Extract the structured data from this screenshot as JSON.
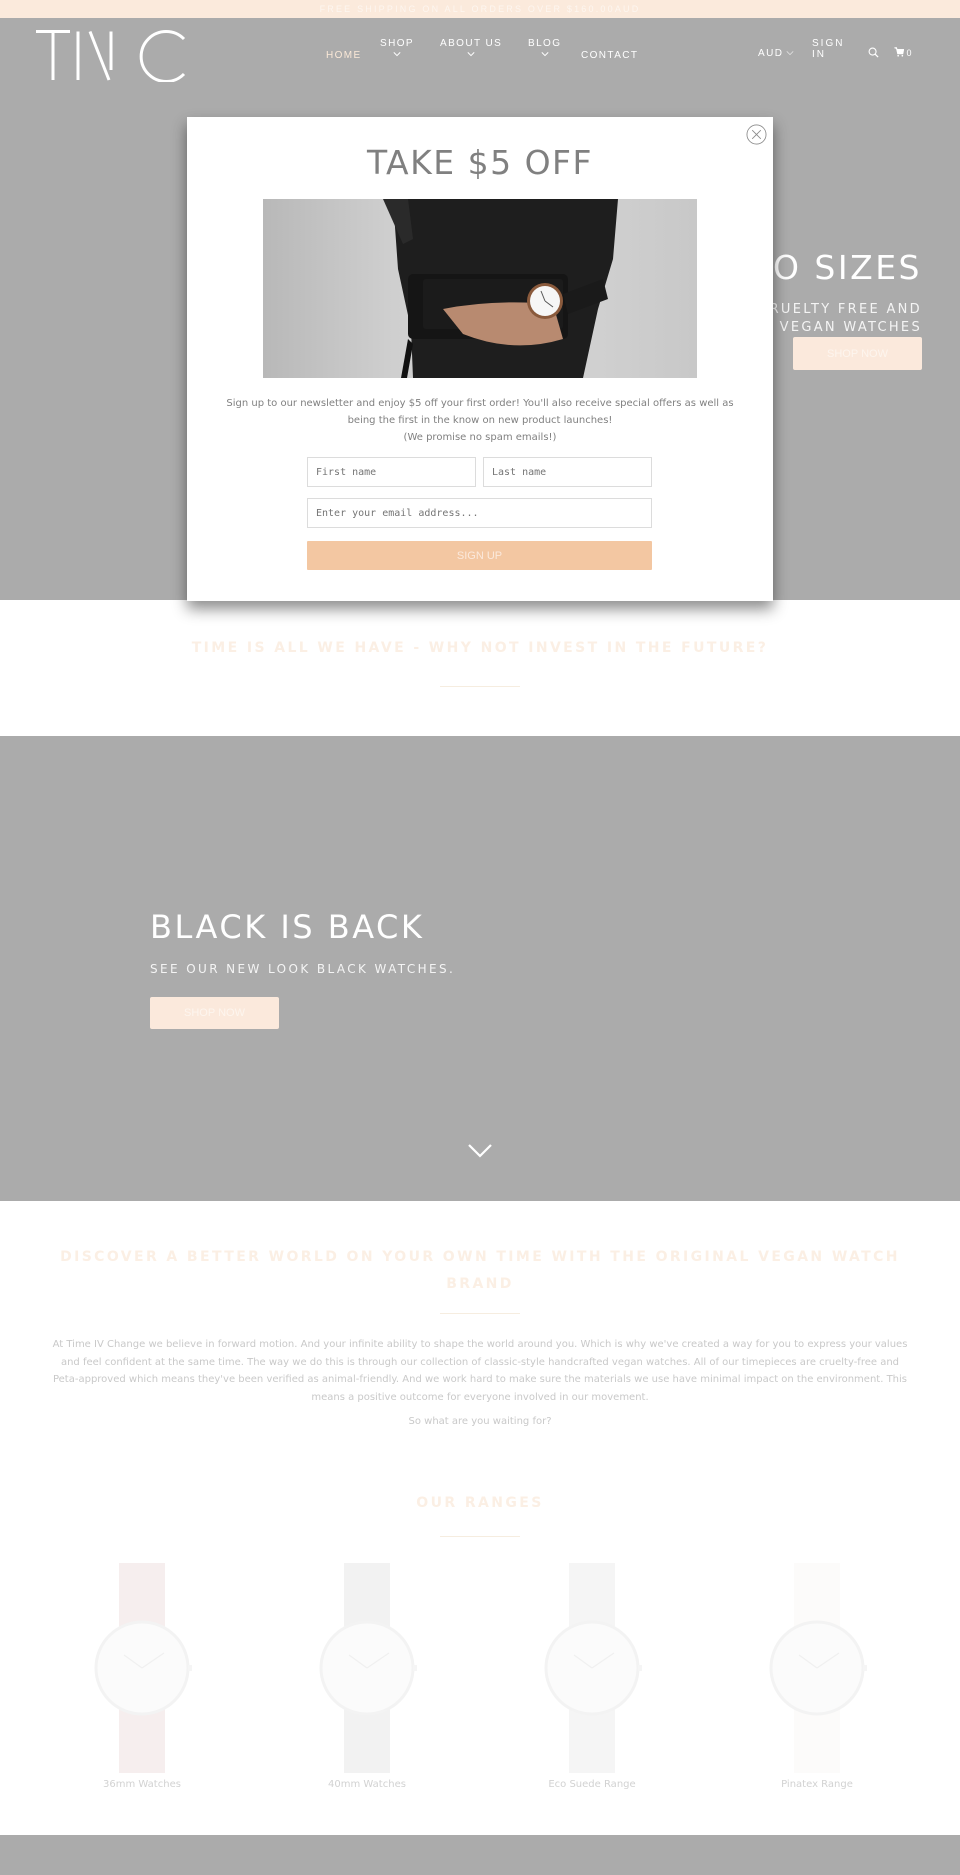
{
  "announcement": "FREE SHIPPING ON ALL ORDERS OVER $160.00AUD",
  "header": {
    "logo": "TIVC",
    "nav": [
      {
        "label": "HOME",
        "active": true,
        "dropdown": false
      },
      {
        "label": "SHOP",
        "active": false,
        "dropdown": true
      },
      {
        "label": "ABOUT US",
        "active": false,
        "dropdown": true
      },
      {
        "label": "BLOG",
        "active": false,
        "dropdown": true
      },
      {
        "label": "CONTACT",
        "active": false,
        "dropdown": false
      }
    ],
    "currency": "AUD",
    "sign_in": "SIGN IN",
    "cart_count": "0"
  },
  "hero1": {
    "title": "TWO SIZES",
    "visible_title": "VO SIZES",
    "subtitle": "CRUELTY FREE AND VEGAN WATCHES",
    "button": "SHOP NOW"
  },
  "modal": {
    "title": "TAKE $5 OFF",
    "image_alt": "Man in suit holding black wallet wearing white-face watch",
    "text_line1": "Sign up to our newsletter and enjoy $5 off your first order! You'll also receive special offers as well as being the first in the know on new product launches!",
    "text_line2": "(We promise no spam emails!)",
    "first_name_placeholder": "First name",
    "last_name_placeholder": "Last name",
    "email_placeholder": "Enter your email address...",
    "button": "SIGN UP"
  },
  "tagline": "TIME IS ALL WE HAVE - WHY NOT INVEST IN THE FUTURE?",
  "hero2": {
    "title": "BLACK IS BACK",
    "subtitle": "SEE OUR NEW LOOK BLACK WATCHES.",
    "button": "SHOP NOW"
  },
  "about": {
    "title": "DISCOVER A BETTER WORLD ON YOUR OWN TIME WITH THE ORIGINAL VEGAN WATCH BRAND",
    "body": "At Time IV Change we believe in forward motion. And your infinite ability to shape the world around you. Which is why we've created a way for you to express your values and feel confident at the same time. The way we do this is through our collection of classic-style handcrafted vegan watches. All of our timepieces are cruelty-free and Peta-approved which means they've been verified as animal-friendly. And we work hard to make sure the materials we use have minimal impact on the environment. This means a positive outcome for everyone involved in our movement.",
    "cta": "So what are you waiting for?"
  },
  "ranges": {
    "title": "OUR RANGES",
    "items": [
      {
        "label": "36mm Watches",
        "strap_color": "#f6eeee"
      },
      {
        "label": "40mm Watches",
        "strap_color": "#f2f2f2"
      },
      {
        "label": "Eco Suede Range",
        "strap_color": "#f5f5f5"
      },
      {
        "label": "Pinatex Range",
        "strap_color": "#fcfbfa"
      }
    ]
  },
  "colors": {
    "hero_gray": "#ababab",
    "accent_peach": "#f3c7a2",
    "light_peach": "#fbe9dc"
  }
}
